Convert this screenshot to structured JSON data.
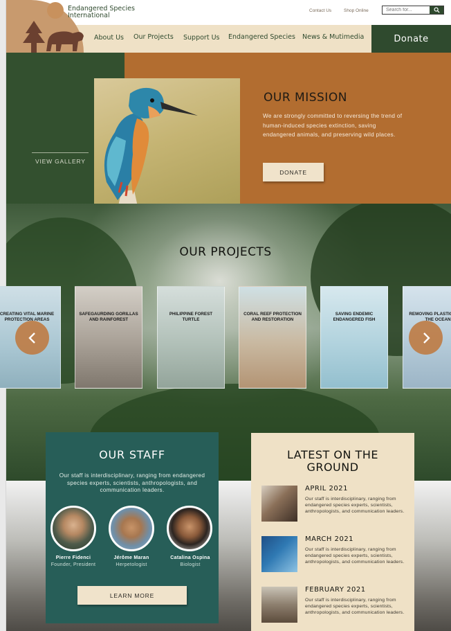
{
  "header": {
    "org_line1": "Endangered Species",
    "org_line2": "International",
    "contact_link": "Contact Us",
    "shop_link": "Shop Online",
    "search_placeholder": "Search for...",
    "nav": [
      "About Us",
      "Our Projects",
      "Support Us",
      "Endangered Species",
      "News & Mutimedia"
    ],
    "donate_label": "Donate"
  },
  "mission": {
    "gallery_link": "VIEW GALLERY",
    "title": "OUR MISSION",
    "body": "We are strongly committed to reversing the trend of human-induced species extinction, saving endangered animals, and preserving wild places.",
    "donate_label": "DONATE"
  },
  "projects": {
    "title": "OUR PROJECTS",
    "cards": [
      {
        "label": "CREATING VITAL MARINE PROTECTION AREAS"
      },
      {
        "label": "SAFEGAURDING GORILLAS AND RAINFOREST"
      },
      {
        "label": "PHILIPPINE FOREST TURTLE"
      },
      {
        "label": "CORAL REEF PROTECTION AND RESTORATION"
      },
      {
        "label": "SAVING ENDEMIC ENDANGERED FISH"
      },
      {
        "label": "REMOVING PLASTIC FROM THE OCEAN"
      }
    ]
  },
  "staff": {
    "title": "OUR STAFF",
    "body": "Our staff is interdisciplinary, ranging from endangered species experts, scientists, anthropologists, and communication leaders.",
    "members": [
      {
        "name": "Pierre Fidenci",
        "role": "Founder, President"
      },
      {
        "name": "Jérôme Maran",
        "role": "Herpetologist"
      },
      {
        "name": "Catalina Ospina",
        "role": "Biologist"
      }
    ],
    "button_label": "LEARN MORE"
  },
  "news": {
    "title_line1": "LATEST ON THE",
    "title_line2": "GROUND",
    "items": [
      {
        "date": "APRIL 2021",
        "text": "Our staff is interdisciplinary, ranging from endangered species experts, scientists, anthropologists, and communication leaders."
      },
      {
        "date": "MARCH 2021",
        "text": "Our staff is interdisciplinary, ranging from endangered species experts, scientists, anthropologists, and communication leaders."
      },
      {
        "date": "FEBRUARY 2021",
        "text": "Our staff is interdisciplinary, ranging from endangered species experts, scientists, anthropologists, and communication leaders."
      }
    ]
  },
  "colors": {
    "forest_green": "#2f4a2e",
    "rust_orange": "#b26d30",
    "sand": "#efe1c6",
    "teal": "#275e58"
  }
}
